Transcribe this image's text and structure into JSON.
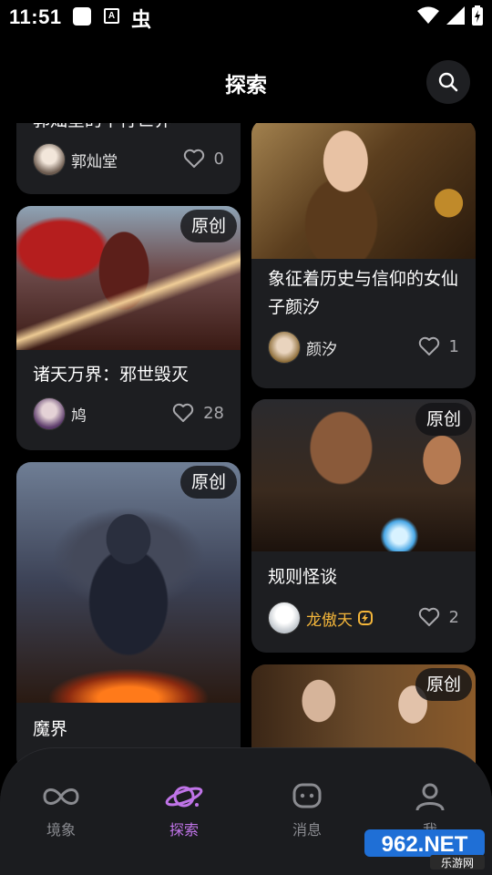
{
  "status": {
    "time": "11:51",
    "notif_letter": "A",
    "notif_glyph": "虫"
  },
  "header": {
    "title": "探索"
  },
  "cards": {
    "c0": {
      "title": "郭灿堂的平行世界",
      "author": "郭灿堂",
      "likes": "0"
    },
    "c1": {
      "title": "象征着历史与信仰的女仙子颜汐",
      "author": "颜汐",
      "likes": "1"
    },
    "c2": {
      "badge": "原创",
      "title": "诸天万界：邪世毁灭",
      "author": "鸠",
      "likes": "28"
    },
    "c3": {
      "badge": "原创",
      "title": "规则怪谈",
      "author": "龙傲天",
      "likes": "2"
    },
    "c4": {
      "badge": "原创",
      "title": "魔界"
    },
    "c5": {
      "badge": "原创"
    }
  },
  "nav": {
    "items": [
      {
        "label": "境象",
        "icon": "infinity-icon"
      },
      {
        "label": "探索",
        "icon": "planet-icon"
      },
      {
        "label": "消息",
        "icon": "chat-bubble-icon"
      },
      {
        "label": "我",
        "icon": "person-icon"
      }
    ],
    "active_color": "#c074e8"
  },
  "watermark": {
    "main": "962.NET",
    "sub": "乐游网"
  }
}
